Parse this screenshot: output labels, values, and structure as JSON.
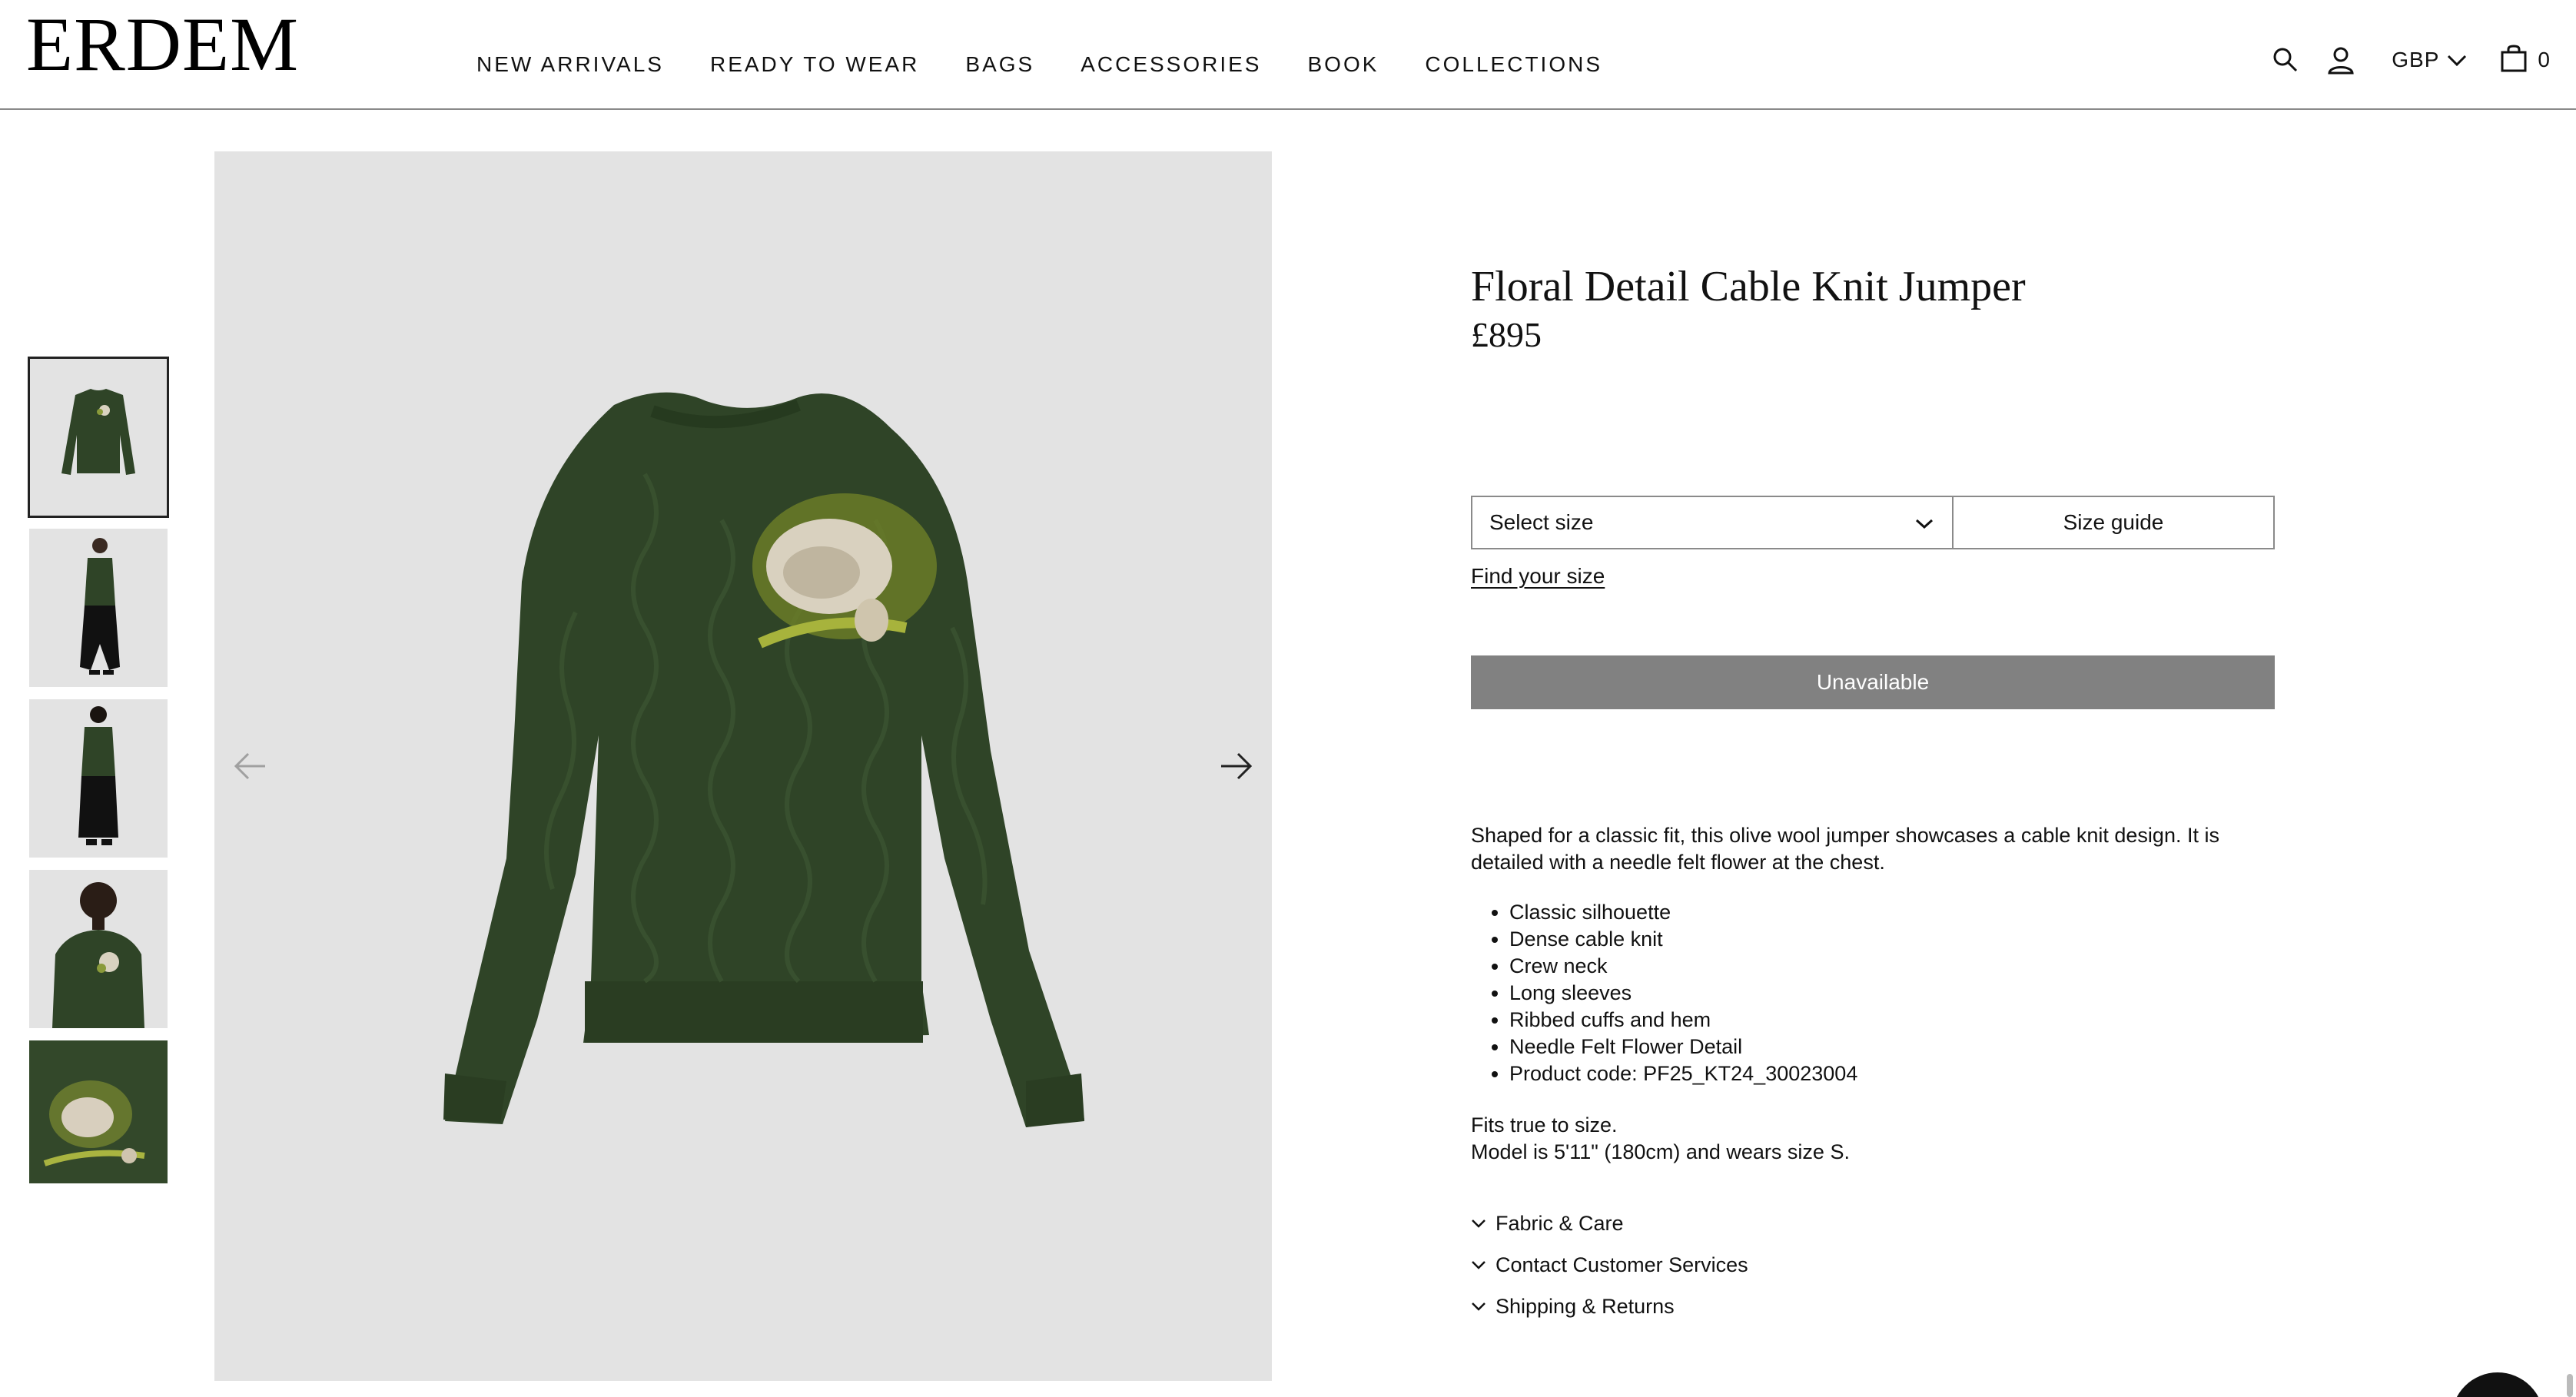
{
  "header": {
    "logo": "ERDEM",
    "nav": [
      "NEW ARRIVALS",
      "READY TO WEAR",
      "BAGS",
      "ACCESSORIES",
      "BOOK",
      "COLLECTIONS"
    ],
    "currency": "GBP",
    "bag_count": "0",
    "icons": [
      "search-icon",
      "account-icon",
      "chevron-down-icon",
      "bag-icon"
    ]
  },
  "gallery": {
    "thumbnails": [
      "front-flat",
      "model-side",
      "model-back",
      "model-front-crop",
      "detail-closeup"
    ],
    "active_index": 0,
    "icons": [
      "arrow-left-icon",
      "arrow-right-icon"
    ]
  },
  "product": {
    "title": "Floral Detail Cable Knit Jumper",
    "price": "£895",
    "size_placeholder": "Select size",
    "size_guide": "Size guide",
    "find_size": "Find your size",
    "cta": "Unavailable",
    "description": "Shaped for a classic fit, this olive wool jumper showcases a cable knit design. It is detailed with a needle felt flower at the chest.",
    "features": [
      "Classic silhouette",
      "Dense cable knit",
      "Crew neck",
      "Long sleeves",
      "Ribbed cuffs and hem",
      "Needle Felt Flower Detail",
      "Product code: PF25_KT24_30023004"
    ],
    "fit_line1": "Fits true to size.",
    "fit_line2": "Model is 5'11\" (180cm) and wears size S.",
    "accordion": [
      "Fabric & Care",
      "Contact Customer Services",
      "Shipping & Returns"
    ]
  },
  "colors": {
    "jumper": "#2f4427",
    "image_bg": "#e3e3e3",
    "button_disabled": "#818181",
    "border": "#8a8a8a"
  }
}
